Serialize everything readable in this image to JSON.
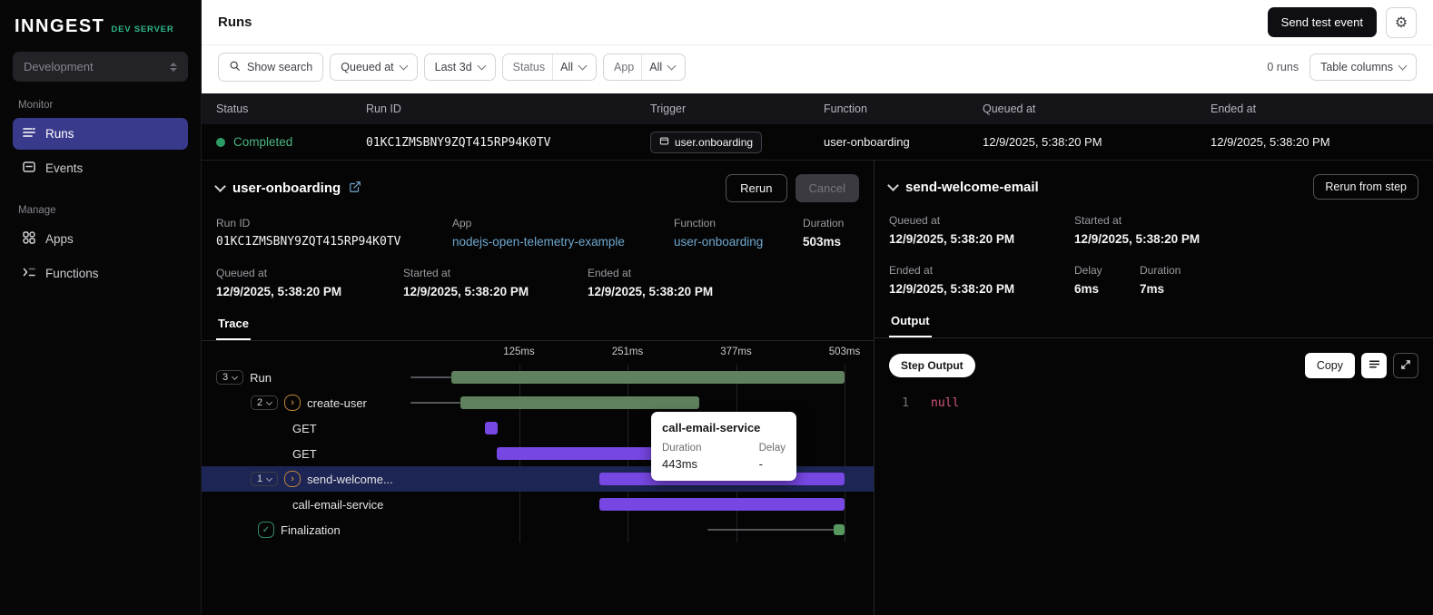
{
  "colors": {
    "brand_green": "#2cb78a",
    "status_completed": "#4cb782",
    "trace_bar_green": "#5f815d",
    "trace_bar_purple": "#7747e3",
    "link": "#6fa8d0",
    "nav_active_bg": "#3a3a8c",
    "null_literal": "#d0587a"
  },
  "sidebar": {
    "logo": "INNGEST",
    "logo_badge": "DEV SERVER",
    "environment": "Development",
    "sections": [
      {
        "label": "Monitor",
        "items": [
          {
            "label": "Runs"
          },
          {
            "label": "Events"
          }
        ]
      },
      {
        "label": "Manage",
        "items": [
          {
            "label": "Apps"
          },
          {
            "label": "Functions"
          }
        ]
      }
    ]
  },
  "topbar": {
    "title": "Runs",
    "send_test_event": "Send test event"
  },
  "filters": {
    "show_search": "Show search",
    "queued_at": "Queued at",
    "time_range": "Last 3d",
    "status_label": "Status",
    "status_value": "All",
    "app_label": "App",
    "app_value": "All",
    "runs_count": "0 runs",
    "table_columns": "Table columns"
  },
  "table": {
    "columns": [
      "Status",
      "Run ID",
      "Trigger",
      "Function",
      "Queued at",
      "Ended at"
    ],
    "row": {
      "status": "Completed",
      "run_id": "01KC1ZMSBNY9ZQT415RP94K0TV",
      "trigger": "user.onboarding",
      "function": "user-onboarding",
      "queued_at": "12/9/2025, 5:38:20 PM",
      "ended_at": "12/9/2025, 5:38:20 PM"
    }
  },
  "run_details": {
    "title": "user-onboarding",
    "rerun": "Rerun",
    "cancel": "Cancel",
    "run_id_label": "Run ID",
    "run_id": "01KC1ZMSBNY9ZQT415RP94K0TV",
    "app_label": "App",
    "app": "nodejs-open-telemetry-example",
    "function_label": "Function",
    "function": "user-onboarding",
    "duration_label": "Duration",
    "duration": "503ms",
    "queued_at_label": "Queued at",
    "queued_at": "12/9/2025, 5:38:20 PM",
    "started_at_label": "Started at",
    "started_at": "12/9/2025, 5:38:20 PM",
    "ended_at_label": "Ended at",
    "ended_at": "12/9/2025, 5:38:20 PM",
    "tab": "Trace"
  },
  "trace": {
    "axis": [
      "125ms",
      "251ms",
      "377ms",
      "503ms"
    ],
    "rows": [
      {
        "collapse": "3",
        "label": "Run"
      },
      {
        "collapse": "2",
        "label": "create-user"
      },
      {
        "label": "GET"
      },
      {
        "label": "GET"
      },
      {
        "collapse": "1",
        "label": "send-welcome..."
      },
      {
        "label": "call-email-service"
      },
      {
        "label": "Finalization"
      }
    ],
    "tooltip": {
      "title": "call-email-service",
      "duration_label": "Duration",
      "duration": "443ms",
      "delay_label": "Delay",
      "delay": "-"
    }
  },
  "step_details": {
    "title": "send-welcome-email",
    "rerun_from_step": "Rerun from step",
    "queued_at_label": "Queued at",
    "queued_at": "12/9/2025, 5:38:20 PM",
    "started_at_label": "Started at",
    "started_at": "12/9/2025, 5:38:20 PM",
    "ended_at_label": "Ended at",
    "ended_at": "12/9/2025, 5:38:20 PM",
    "delay_label": "Delay",
    "delay": "6ms",
    "duration_label": "Duration",
    "duration": "7ms",
    "tab": "Output",
    "output_badge": "Step Output",
    "copy": "Copy",
    "code": {
      "line_number": "1",
      "value": "null"
    }
  }
}
